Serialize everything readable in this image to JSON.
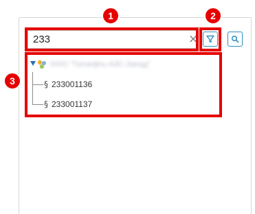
{
  "search": {
    "value": "233",
    "clear_glyph": "×"
  },
  "buttons": {
    "filter_icon": "filter-icon",
    "search_icon": "search-icon",
    "accent": "#2a8fbf"
  },
  "tree": {
    "root_label": "ООО \"Татнефть-АЗС-Запад\"",
    "children": [
      {
        "glyph": "§",
        "label": "233001136"
      },
      {
        "glyph": "§",
        "label": "233001137"
      }
    ]
  },
  "annotations": {
    "color": "#e60000",
    "badges": [
      "1",
      "2",
      "3"
    ]
  }
}
